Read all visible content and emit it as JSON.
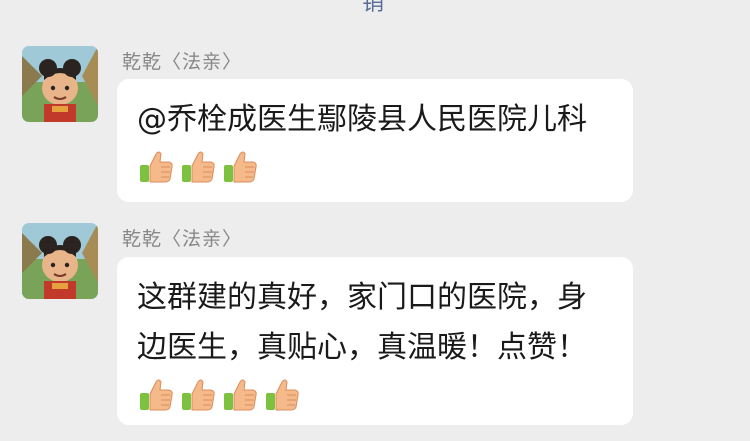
{
  "header": {
    "partial_text": "销"
  },
  "messages": [
    {
      "sender": "乾乾〈法亲〉",
      "lines": [
        "@乔栓成医生鄢陵县人民医院儿科"
      ],
      "thumbs_count": 3,
      "avatar_icon": "cartoon-character-avatar"
    },
    {
      "sender": "乾乾〈法亲〉",
      "lines": [
        "这群建的真好，家门口的医院，身",
        "边医生，真贴心，真温暖！点赞！"
      ],
      "thumbs_count": 4,
      "avatar_icon": "cartoon-character-avatar"
    }
  ],
  "colors": {
    "background": "#ededed",
    "bubble": "#ffffff",
    "sender_text": "#888888",
    "link_blue": "#576b95"
  }
}
